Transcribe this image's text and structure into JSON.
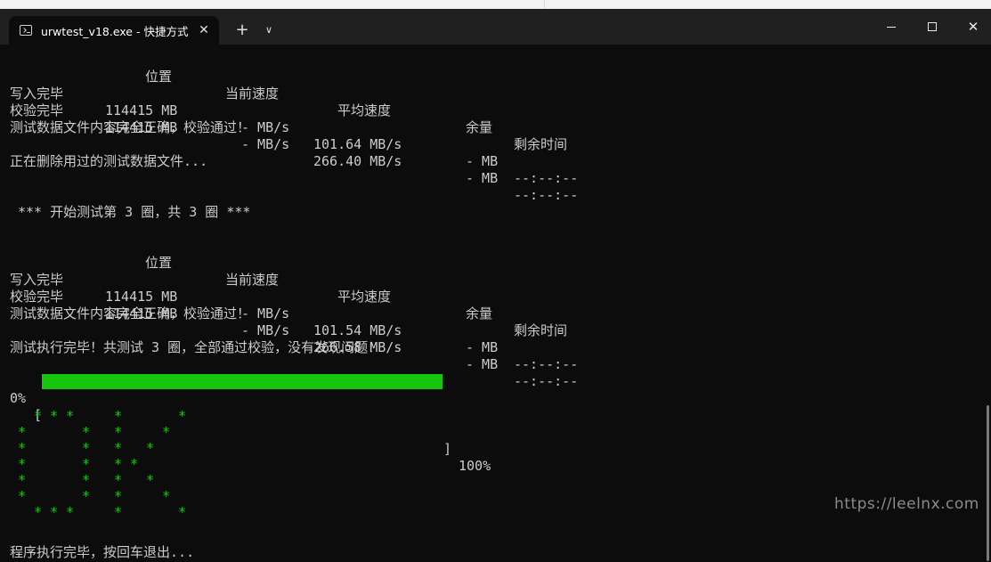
{
  "window": {
    "tab_title": "urwtest_v18.exe - 快捷方式",
    "new_tab_label": "+",
    "dropdown_label": "∨",
    "close_tab_label": "✕",
    "close_window_label": "✕"
  },
  "terminal": {
    "round2": {
      "header": {
        "pos": "位置",
        "cur": "当前速度",
        "avg": "平均速度",
        "rem": "余量",
        "time": "剩余时间"
      },
      "rows": [
        {
          "label": "写入完毕",
          "pos": "114415 MB",
          "cur": "- MB/s",
          "avg": "101.64 MB/s",
          "rem": "- MB",
          "time": "--:--:--"
        },
        {
          "label": "校验完毕",
          "pos": "114415 MB",
          "cur": "- MB/s",
          "avg": "266.40 MB/s",
          "rem": "- MB",
          "time": "--:--:--"
        }
      ],
      "verify_ok": "测试数据文件内容完全正确，校验通过！",
      "deleting": "正在删除用过的测试数据文件..."
    },
    "round3_banner": "*** 开始测试第 3 圈，共 3 圈 ***",
    "round3": {
      "header": {
        "pos": "位置",
        "cur": "当前速度",
        "avg": "平均速度",
        "rem": "余量",
        "time": "剩余时间"
      },
      "rows": [
        {
          "label": "写入完毕",
          "pos": "114415 MB",
          "cur": "- MB/s",
          "avg": "101.54 MB/s",
          "rem": "- MB",
          "time": "--:--:--"
        },
        {
          "label": "校验完毕",
          "pos": "114415 MB",
          "cur": "- MB/s",
          "avg": "266.58 MB/s",
          "rem": "- MB",
          "time": "--:--:--"
        }
      ],
      "verify_ok": "测试数据文件内容完全正确，校验通过！"
    },
    "summary": "测试执行完毕！共测试 3 圈，全部通过校验，没有发现问题！",
    "progress": {
      "min_label": "0%",
      "bracket_left": "[",
      "bracket_right": "]",
      "max_label": "100%",
      "fraction": 1.0
    },
    "ok_art_char": "*",
    "exit_prompt": "程序执行完毕，按回车退出..."
  },
  "watermark": "https://leelnx.com",
  "colors": {
    "terminal_bg": "#0c0c0c",
    "progress_green": "#16c60c",
    "text": "#cccccc"
  }
}
